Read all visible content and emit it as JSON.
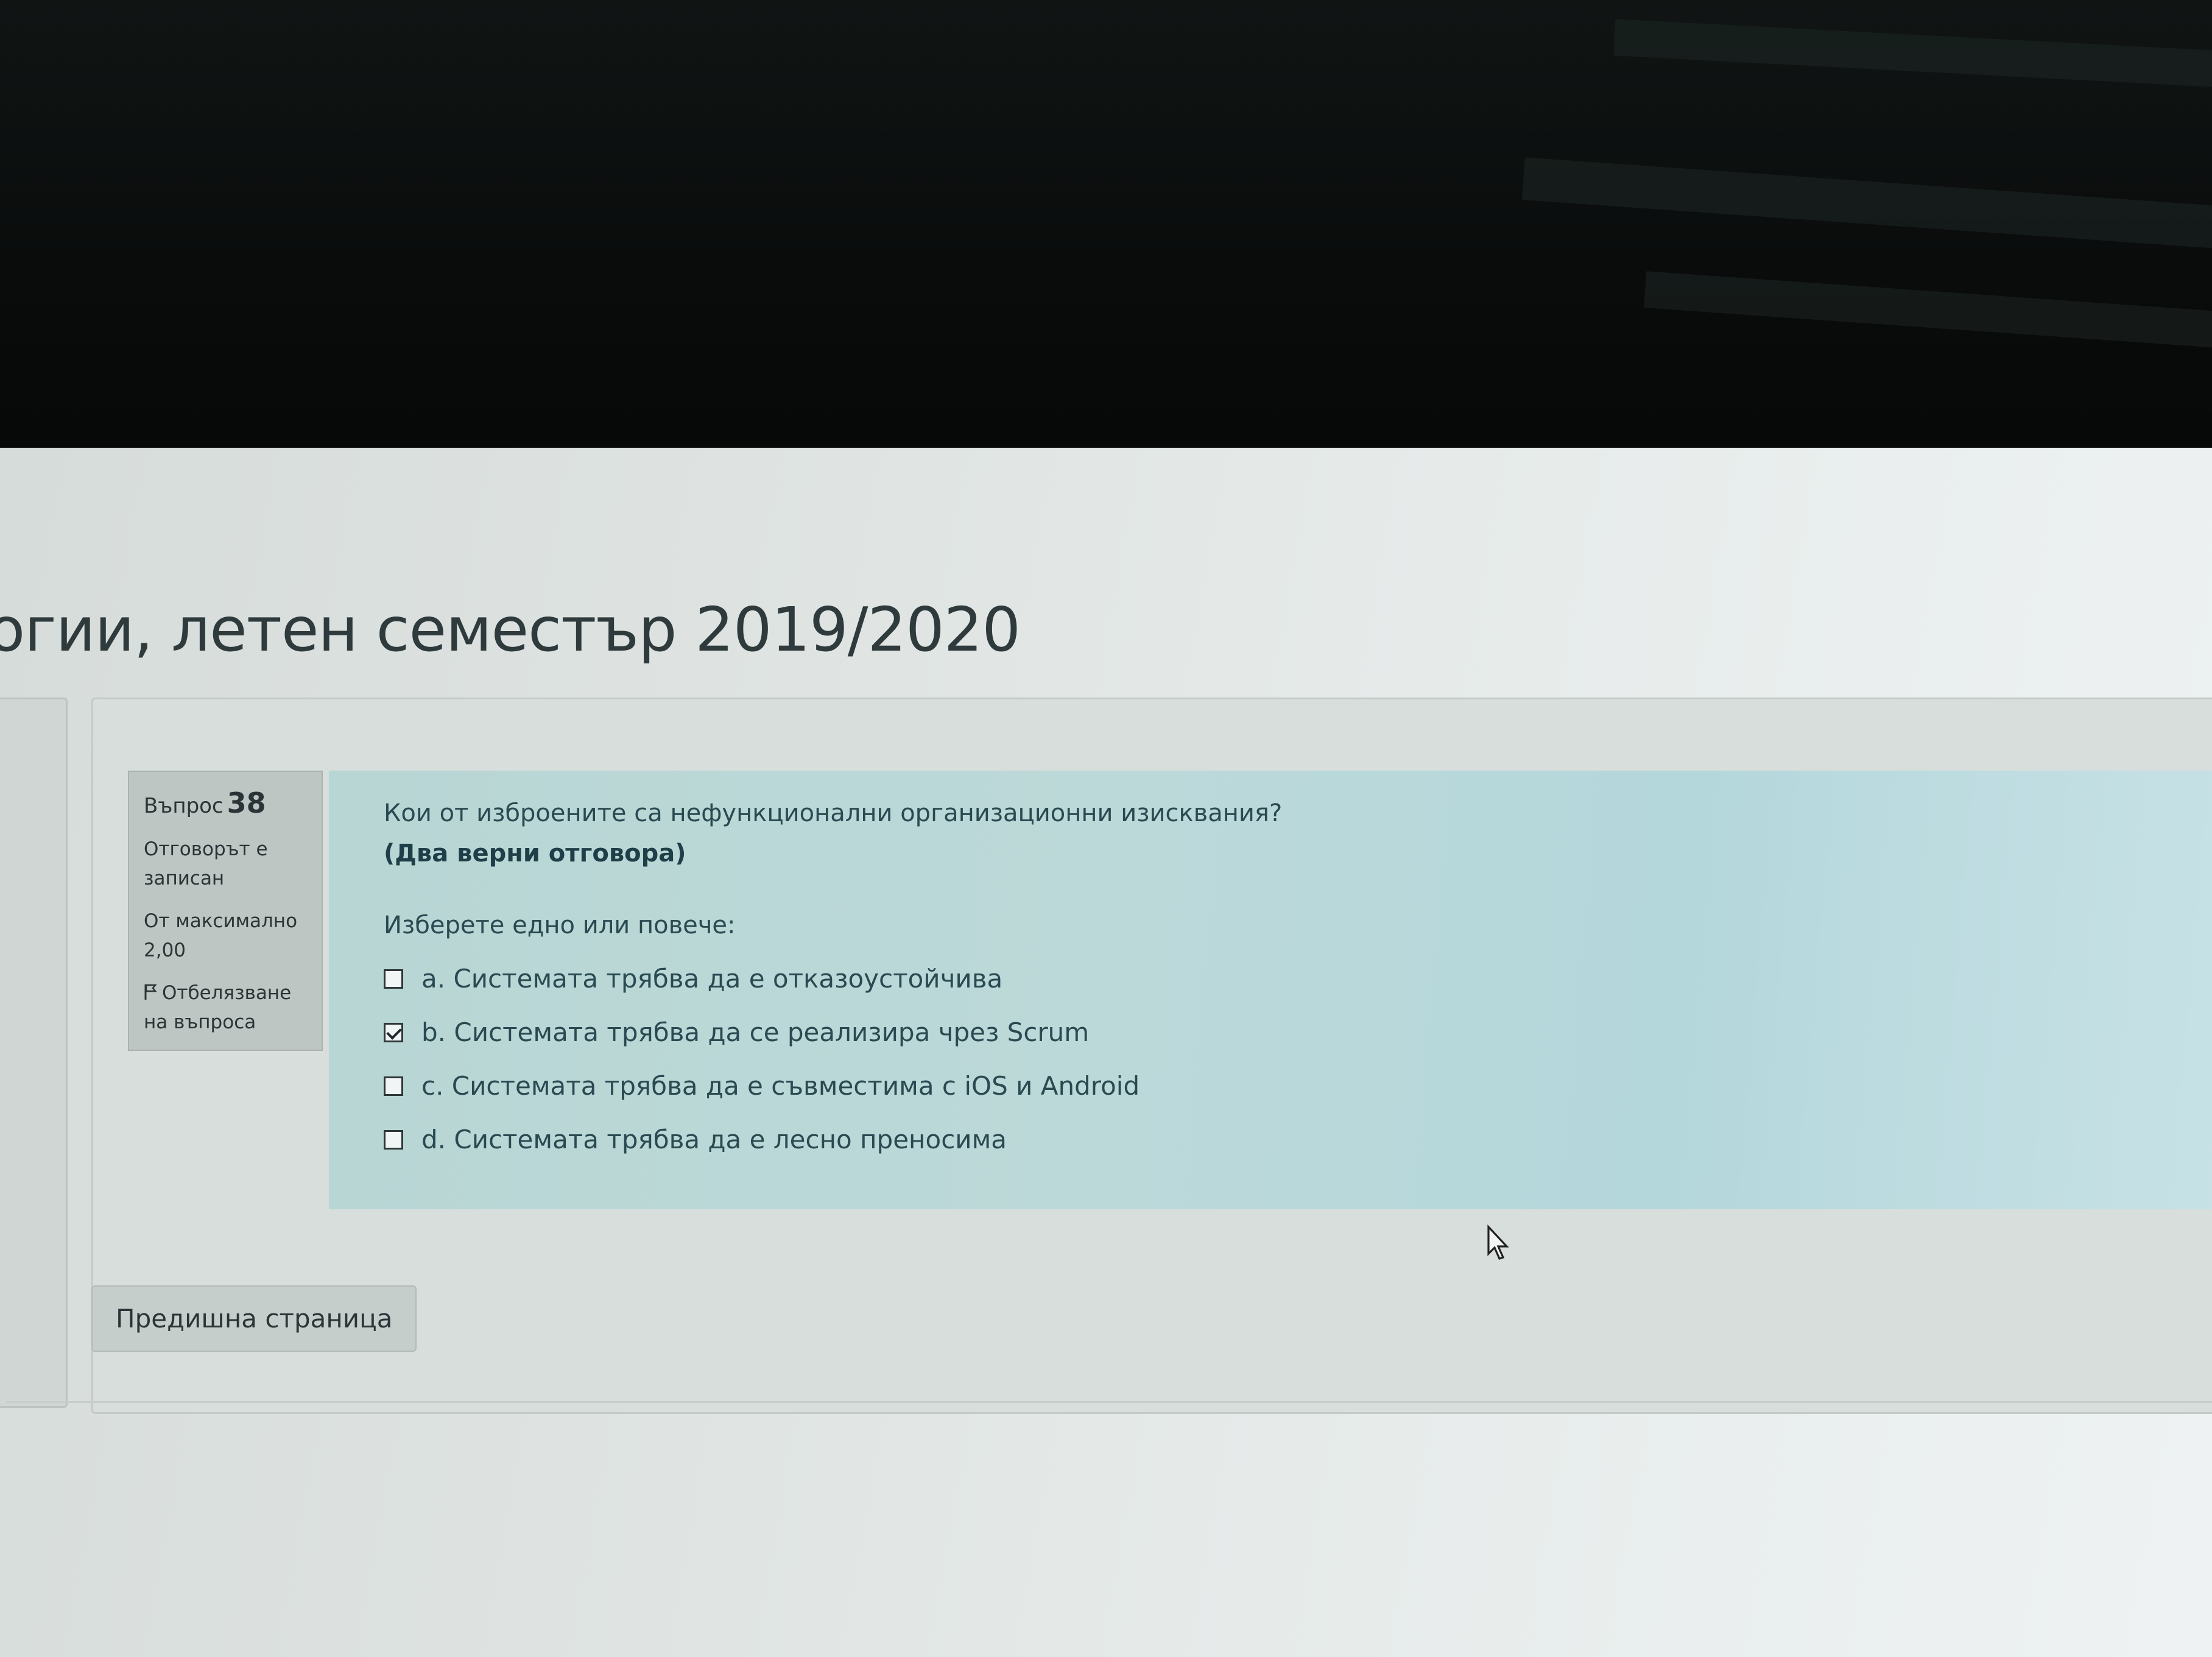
{
  "page": {
    "title": "огии, летен семестър 2019/2020"
  },
  "question_info": {
    "label": "Въпрос",
    "number": "38",
    "status_line1": "Отговорът е",
    "status_line2": "записан",
    "max_line1": "От максимално",
    "max_line2": "2,00",
    "flag_line1": "Отбелязване",
    "flag_line2": "на въпроса",
    "flag_icon": "flag-icon"
  },
  "question": {
    "text": "Кои от изброените са нефункционални организационни изисквания?",
    "hint": "(Два верни отговора)",
    "prompt": "Изберете едно или повече:",
    "options": [
      {
        "label": "a. Системата трябва да е отказоустойчива",
        "checked": false
      },
      {
        "label": "b. Системата трябва да се реализира чрез Scrum",
        "checked": true
      },
      {
        "label": "c. Системата трябва да е съвместима с iOS и Android",
        "checked": false
      },
      {
        "label": "d. Системата трябва да е лесно преносима",
        "checked": false
      }
    ]
  },
  "navigation": {
    "previous_label": "Предишна страница"
  }
}
